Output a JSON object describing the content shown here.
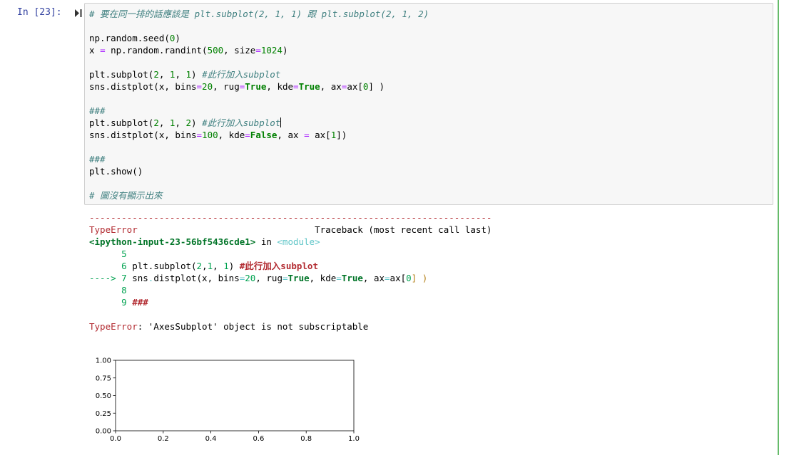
{
  "cell": {
    "prompt": "In [23]:",
    "code": {
      "l1": "# 要在同一排的話應該是 plt.subplot(2, 1, 1) 跟 plt.subplot(2, 1, 2)",
      "seed_pre": "np.random.seed(",
      "seed_num": "0",
      "seed_post": ")",
      "x_pre": "x ",
      "x_eq": "=",
      "x_mid": " np.random.randint(",
      "x_n1": "500",
      "x_mid2": ", size",
      "x_eq2": "=",
      "x_n2": "1024",
      "x_post": ")",
      "sp1_pre": "plt.subplot(",
      "sp1_a": "2",
      "sp1_c1": ", ",
      "sp1_b": "1",
      "sp1_c2": ", ",
      "sp1_c": "1",
      "sp1_post": ") ",
      "sp1_com": "#此行加入subplot",
      "d1_pre": "sns.distplot(x, bins",
      "d1_eq": "=",
      "d1_n": "20",
      "d1_m1": ", rug",
      "d1_eq2": "=",
      "d1_true1": "True",
      "d1_m2": ", kde",
      "d1_eq3": "=",
      "d1_true2": "True",
      "d1_m3": ", ax",
      "d1_eq4": "=",
      "d1_m4": "ax[",
      "d1_idx": "0",
      "d1_post": "] )",
      "hash1": "###",
      "sp2_pre": "plt.subplot(",
      "sp2_a": "2",
      "sp2_c1": ", ",
      "sp2_b": "1",
      "sp2_c2": ", ",
      "sp2_c": "2",
      "sp2_post": ") ",
      "sp2_com": "#此行加入subplot",
      "d2_pre": "sns.distplot(x, bins",
      "d2_eq": "=",
      "d2_n": "100",
      "d2_m1": ", kde",
      "d2_eq2": "=",
      "d2_false": "False",
      "d2_m2": ", ax ",
      "d2_eq3": "=",
      "d2_m3": " ax[",
      "d2_idx": "1",
      "d2_post": "])",
      "hash2": "###",
      "show": "plt.show()",
      "last_com": "# 圖沒有顯示出來"
    },
    "output": {
      "dashes": "---------------------------------------------------------------------------",
      "err_name": "TypeError",
      "traceback": "                                 Traceback (most recent call last)",
      "input_ref": "<ipython-input-23-56bf5436cde1>",
      "in_word": " in ",
      "module": "<module>",
      "line5_num": "      5",
      "line6_num": "      6 ",
      "line6_pre": "plt.subplot(",
      "line6_a": "2",
      "line6_b": ",",
      "line6_c": "1",
      "line6_d": ", ",
      "line6_e": "1",
      "line6_f": ") ",
      "line6_com": "#此行加入subplot",
      "arrow": "----> 7 ",
      "line7_pre": "sns",
      "line7_dot": ".",
      "line7_a": "distplot(x, bins",
      "line7_eq": "=",
      "line7_n": "20",
      "line7_b": ", rug",
      "line7_eq2": "=",
      "line7_t1": "True",
      "line7_c": ", kde",
      "line7_eq3": "=",
      "line7_t2": "True",
      "line7_d": ", ax",
      "line7_eq4": "=",
      "line7_e": "ax[",
      "line7_idx": "0",
      "line7_f": "] )",
      "line8_num": "      8",
      "line9_num": "      9 ",
      "line9_hash": "###",
      "final_err": "TypeError",
      "final_msg": ": 'AxesSubplot' object is not subscriptable"
    }
  },
  "chart_data": {
    "type": "line",
    "series": [],
    "xlim": [
      0,
      1
    ],
    "ylim": [
      0,
      1
    ],
    "xticks": [
      "0.0",
      "0.2",
      "0.4",
      "0.6",
      "0.8",
      "1.0"
    ],
    "yticks": [
      "0.00",
      "0.25",
      "0.50",
      "0.75",
      "1.00"
    ],
    "grid": false
  }
}
